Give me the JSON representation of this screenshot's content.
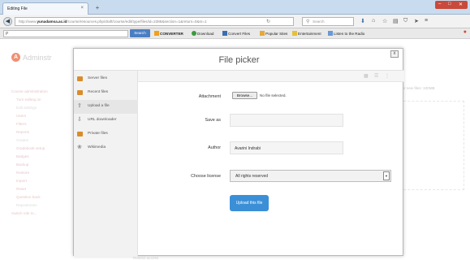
{
  "browser": {
    "tab_title": "Editing File",
    "tab_close": "×",
    "new_tab": "+",
    "url_prefix": "http://www.",
    "url_domain": "yunadamsa.ac.id",
    "url_rest": "/course/resources.php/draft/course/edit/type/files/id=2386&section=1&return=0&sr=1",
    "search_placeholder": "Search",
    "location_input": "P",
    "search_button": "Search",
    "bookmarks": [
      "CONVERTER",
      "Download",
      "Convert Files",
      "Popular Sites",
      "Entertainment",
      "Listen to the Radio"
    ]
  },
  "page": {
    "site_name": "Adminstr",
    "nav": [
      "Course administration",
      "Turn editing on",
      "Edit settings",
      "Users",
      "Filters",
      "Reports",
      "Grades",
      "Gradebook setup",
      "Badges",
      "Backup",
      "Restore",
      "Import",
      "Reset",
      "Question bank",
      "Repositories",
      "Switch role to..."
    ],
    "right_limit": "for new files: 100MB",
    "bottom_text": "Restrict access"
  },
  "modal": {
    "title": "File picker",
    "close": "x",
    "repositories": [
      {
        "label": "Server files",
        "icon": "folder-icon",
        "color": "#d98c2b"
      },
      {
        "label": "Recent files",
        "icon": "folder-icon",
        "color": "#d98c2b"
      },
      {
        "label": "Upload a file",
        "icon": "upload-icon",
        "color": "#6b6b6b"
      },
      {
        "label": "URL downloader",
        "icon": "download-icon",
        "color": "#6b6b6b"
      },
      {
        "label": "Private files",
        "icon": "folder-icon",
        "color": "#d98c2b"
      },
      {
        "label": "Wikimedia",
        "icon": "wikimedia-icon",
        "color": "#8c8c8c"
      }
    ],
    "active_repository": "Upload a file",
    "form": {
      "attachment_label": "Attachment",
      "browse_button": "Browse...",
      "no_file_text": "No file selected.",
      "save_as_label": "Save as",
      "save_as_value": "",
      "author_label": "Author",
      "author_value": "Avarini Indrabi",
      "license_label": "Choose license",
      "license_value": "All rights reserved",
      "upload_button": "Upload this file"
    }
  },
  "colors": {
    "accent": "#3b8fd6",
    "logo": "#e8552a",
    "folder": "#d98c2b"
  }
}
